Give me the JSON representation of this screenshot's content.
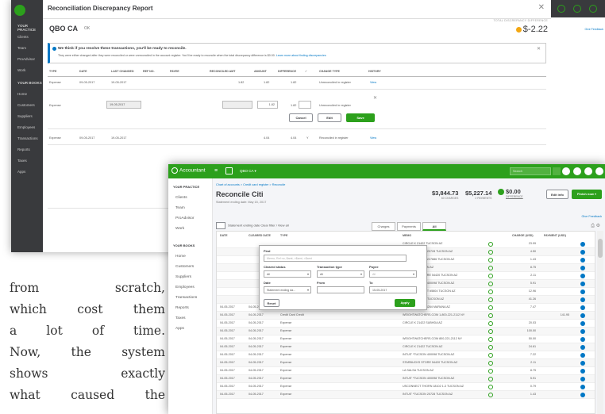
{
  "article": {
    "lines": [
      "from scratch,",
      "which cost them",
      "a lot of time.",
      "Now, the system",
      "shows exactly",
      "what caused the"
    ]
  },
  "back_window": {
    "title": "Reconciliation Discrepancy Report",
    "account": "QBO CA",
    "account_status": "OK",
    "discrepancy_label": "TOTAL DISCREPANCY DIFFERENCE",
    "discrepancy_value": "$-2.22",
    "give_feedback": "Give Feedback",
    "sidebar": {
      "groups": [
        "YOUR PRACTICE",
        "YOUR BOOKS"
      ],
      "practice_items": [
        "Clients",
        "Team",
        "ProAdvisor",
        "Work"
      ],
      "book_items": [
        "Home",
        "Customers",
        "Suppliers",
        "Employees",
        "Transactions",
        "Reports",
        "Taxes",
        "Apps"
      ]
    },
    "banner": {
      "title": "We think if you resolve these transactions, you'll be ready to reconcile.",
      "body": "They were either changed after they were reconciled or were unreconciled in the account register. You'll be ready to reconcile when the total discrepancy difference is $0.00.",
      "link": "Learn more about finding discrepancies"
    },
    "columns": [
      "TYPE",
      "DATE",
      "LAST CHANGED",
      "REF NO.",
      "PAYEE",
      "RECONCILED AMT",
      "AMOUNT",
      "DIFFERENCE",
      "✓",
      "CHANGE TYPE",
      "HISTORY"
    ],
    "rows": [
      {
        "type": "Expense",
        "date": "09-05-2017",
        "changed": "19-05-2017",
        "rec_amt": "1.82",
        "amount": "1.82",
        "diff": "1.82",
        "change": "Unreconciled in register",
        "history": "View"
      },
      {
        "type": "Expense",
        "date": "",
        "changed": "19-05-2017",
        "rec_amt": "",
        "amount": "1.82",
        "diff": "1.82",
        "change": "Unreconciled in register",
        "history": ""
      },
      {
        "type": "Expense",
        "date": "09-05-2017",
        "changed": "19-05-2017",
        "rec_amt": "",
        "amount": "4.04",
        "diff": "4.04",
        "check": "Y",
        "change": "Reconciled in register",
        "history": "View"
      }
    ],
    "buttons": {
      "cancel": "Cancel",
      "edit": "Edit",
      "save": "Save"
    }
  },
  "front_window": {
    "brand": "Accountant",
    "company": "QBO CA",
    "search_placeholder": "Search",
    "sidebar": {
      "groups": [
        "YOUR PRACTICE",
        "YOUR BOOKS"
      ],
      "practice_items": [
        "Clients",
        "Team",
        "ProAdvisor",
        "Work"
      ],
      "book_items": [
        "Home",
        "Customers",
        "Suppliers",
        "Employees",
        "Transactions",
        "Reports",
        "Taxes",
        "Apps"
      ]
    },
    "breadcrumb": "Chart of accounts  >  Credit card register  >  Reconcile",
    "title": "Reconcile  Citi",
    "subtitle": "Statement ending date: May 15, 2017",
    "summary": [
      {
        "value": "$3,844.73",
        "label": "60 CHARGES"
      },
      {
        "value": "$5,227.14",
        "label": "2 PAYMENTS"
      }
    ],
    "difference": {
      "value": "$0.00",
      "label": "DIFFERENCE"
    },
    "edit_info": "Edit info",
    "finish": "Finish now",
    "give_feedback": "Give Feedback",
    "filter_text": "Statement ending date   Clear filter / View all",
    "tabs": [
      "Charges",
      "Payments",
      "All"
    ],
    "columns": [
      "DATE",
      "CLEARED DATE",
      "TYPE",
      "REF NO.",
      "ACCOUNT",
      "PAYEE",
      "MEMO",
      "",
      "CHARGE (USD)",
      "PAYMENT (USD)",
      ""
    ],
    "rows": [
      {
        "date": "",
        "cleared": "",
        "type": "",
        "memo": "CIRCLE K 21422 TUCSON AZ",
        "charge": "23.99",
        "payment": ""
      },
      {
        "date": "",
        "cleared": "",
        "type": "",
        "memo": "INTUIT *TUCSON 20728 TUCSON AZ",
        "charge": "4.50",
        "payment": ""
      },
      {
        "date": "",
        "cleared": "",
        "type": "",
        "memo": "INTUIT *TUCSON 227886 TUCSON AZ",
        "charge": "1.43",
        "payment": ""
      },
      {
        "date": "",
        "cleared": "",
        "type": "",
        "memo": "LA SALSA TUCSON AZ",
        "charge": "8.75",
        "payment": ""
      },
      {
        "date": "",
        "cleared": "",
        "type": "",
        "memo": "STARBUCKS STORE 54420 TUCSON AZ",
        "charge": "2.11",
        "payment": ""
      },
      {
        "date": "",
        "cleared": "",
        "type": "",
        "memo": "INTUIT *TUCSON 400098 TUCSON AZ",
        "charge": "5.91",
        "payment": ""
      },
      {
        "date": "",
        "cleared": "",
        "type": "",
        "memo": "THE HOME DEPOT #5804 TUCSON AZ",
        "charge": "12.96",
        "payment": ""
      },
      {
        "date": "",
        "cleared": "",
        "type": "",
        "memo": "FRY'S FUEL #732 TUCSON AZ",
        "charge": "41.26",
        "payment": ""
      },
      {
        "date": "04-05-2017",
        "cleared": "04-05-2017",
        "type": "Expense",
        "memo": "MCDONALD'S F34264 MARANA AZ",
        "charge": "7.47",
        "payment": ""
      },
      {
        "date": "04-05-2017",
        "cleared": "04-05-2017",
        "type": "Credit Card Credit",
        "memo": "WEIGHTWATCHERS.COM 1-800-221-2112 NY",
        "charge": "",
        "payment": "141.95"
      },
      {
        "date": "04-05-2017",
        "cleared": "04-05-2017",
        "type": "Expense",
        "memo": "CIRCLE K 21422 SUBHDA AZ",
        "charge": "20.03",
        "payment": ""
      },
      {
        "date": "04-05-2017",
        "cleared": "04-05-2017",
        "type": "Expense",
        "memo": "",
        "charge": "100.00",
        "payment": ""
      },
      {
        "date": "04-05-2017",
        "cleared": "04-05-2017",
        "type": "Expense",
        "memo": "WEIGHTWATCHERS.COM 800-221-2112 NY",
        "charge": "50.00",
        "payment": ""
      },
      {
        "date": "04-05-2017",
        "cleared": "04-05-2017",
        "type": "Expense",
        "memo": "CIRCLE K 21422 TUCSON AZ",
        "charge": "24.61",
        "payment": ""
      },
      {
        "date": "04-05-2017",
        "cleared": "04-05-2017",
        "type": "Expense",
        "memo": "INTUIT *TUCSON 400098 TUCSON AZ",
        "charge": "7.22",
        "payment": ""
      },
      {
        "date": "04-05-2017",
        "cleared": "04-05-2017",
        "type": "Expense",
        "memo": "STARBUCKS STORE 54420 TUCSON AZ",
        "charge": "2.11",
        "payment": ""
      },
      {
        "date": "04-05-2017",
        "cleared": "04-05-2017",
        "type": "Expense",
        "memo": "LA SALSA TUCSON AZ",
        "charge": "8.75",
        "payment": ""
      },
      {
        "date": "04-05-2017",
        "cleared": "04-05-2017",
        "type": "Expense",
        "memo": "INTUIT *TUCSON 400098 TUCSON AZ",
        "charge": "5.91",
        "payment": ""
      },
      {
        "date": "04-05-2017",
        "cleared": "04-05-2017",
        "type": "Expense",
        "memo": "USCONNECT THORN 18102 1-3 TUCSON AZ",
        "charge": "0.79",
        "payment": ""
      },
      {
        "date": "04-05-2017",
        "cleared": "04-05-2017",
        "type": "Expense",
        "memo": "INTUIT *TUCSON 20728 TUCSON AZ",
        "charge": "1.43",
        "payment": ""
      }
    ],
    "filter_popup": {
      "find_label": "Find",
      "find_placeholder": "Memo, Ref no, $amt, >$amt, <$amt",
      "cleared_label": "Cleared status",
      "cleared_value": "All",
      "ttype_label": "Transaction type",
      "ttype_value": "All",
      "payee_label": "Payee",
      "payee_value": "All",
      "date_label": "Date",
      "date_value": "Statement ending da...",
      "from_label": "From",
      "to_label": "To",
      "to_value": "15-05-2017",
      "reset": "Reset",
      "apply": "Apply"
    }
  },
  "colors": {
    "brand_green": "#2ca01c",
    "link_blue": "#0077c5",
    "dark": "#393a3d",
    "warning": "#f3a712"
  }
}
